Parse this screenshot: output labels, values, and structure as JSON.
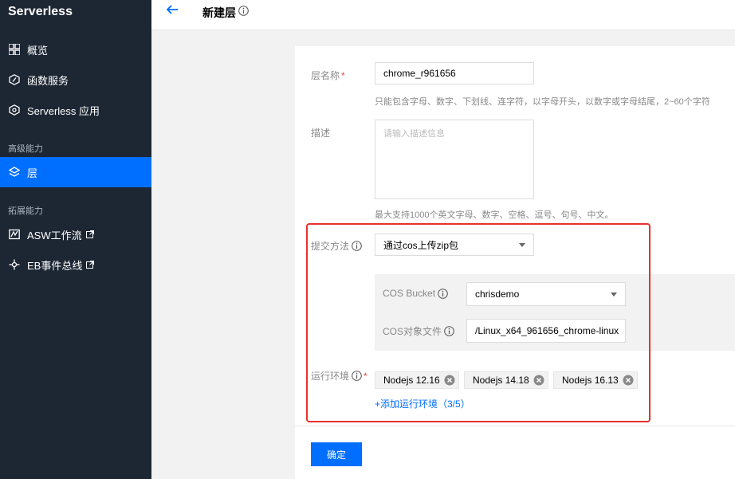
{
  "sidebar": {
    "brand": "Serverless",
    "items_top": [
      {
        "label": "概览",
        "icon": "grid-icon"
      },
      {
        "label": "函数服务",
        "icon": "function-icon"
      },
      {
        "label": "Serverless 应用",
        "icon": "app-icon"
      }
    ],
    "section_advanced": "高级能力",
    "active_item": {
      "label": "层",
      "icon": "layers-icon"
    },
    "section_extend": "拓展能力",
    "items_extend": [
      {
        "label": "ASW工作流",
        "icon": "workflow-icon"
      },
      {
        "label": "EB事件总线",
        "icon": "eventbus-icon"
      }
    ]
  },
  "header": {
    "title": "新建层"
  },
  "form": {
    "name_label": "层名称",
    "name_value": "chrome_r961656",
    "name_hint": "只能包含字母、数字、下划线、连字符，以字母开头，以数字或字母结尾，2~60个字符",
    "desc_label": "描述",
    "desc_placeholder": "请输入描述信息",
    "desc_hint": "最大支持1000个英文字母、数字、空格、逗号、句号、中文。",
    "submit_label": "提交方法",
    "submit_value": "通过cos上传zip包",
    "cos_bucket_label": "COS Bucket",
    "cos_bucket_value": "chrisdemo",
    "cos_file_label": "COS对象文件",
    "cos_file_value": "/Linux_x64_961656_chrome-linux",
    "runtime_label": "运行环境",
    "runtimes": [
      "Nodejs 12.16",
      "Nodejs 14.18",
      "Nodejs 16.13"
    ],
    "add_runtime": "+添加运行环境（3/5）",
    "confirm": "确定"
  },
  "colors": {
    "sidebar_bg": "#1d2633",
    "accent": "#006eff",
    "highlight": "#e8312b"
  }
}
